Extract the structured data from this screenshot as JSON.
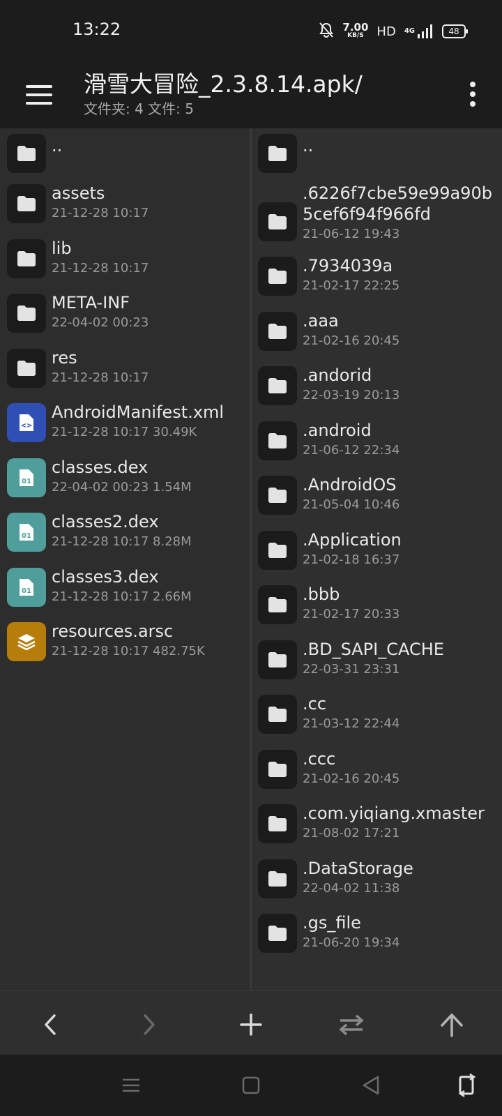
{
  "status_bar": {
    "time": "13:22",
    "net_speed_value": "7.00",
    "net_speed_unit": "KB/S",
    "hd_label": "HD",
    "network_type": "4G",
    "battery": "48",
    "icons": [
      "bell-off-icon",
      "signal-icon",
      "battery-icon"
    ]
  },
  "toolbar": {
    "title": "滑雪大冒险_2.3.8.14.apk/",
    "subtitle": "文件夹: 4  文件: 5",
    "icons": [
      "hamburger-menu-icon",
      "more-vert-icon"
    ]
  },
  "left_pane": {
    "items": [
      {
        "name": "..",
        "meta": "",
        "icon": "folder-icon",
        "type": "folder"
      },
      {
        "name": "assets",
        "meta": "21-12-28 10:17",
        "icon": "folder-icon",
        "type": "folder"
      },
      {
        "name": "lib",
        "meta": "21-12-28 10:17",
        "icon": "folder-icon",
        "type": "folder"
      },
      {
        "name": "META-INF",
        "meta": "22-04-02 00:23",
        "icon": "folder-icon",
        "type": "folder"
      },
      {
        "name": "res",
        "meta": "21-12-28 10:17",
        "icon": "folder-icon",
        "type": "folder"
      },
      {
        "name": "AndroidManifest.xml",
        "meta": "21-12-28 10:17  30.49K",
        "icon": "xml-file-icon",
        "type": "xml"
      },
      {
        "name": "classes.dex",
        "meta": "22-04-02 00:23  1.54M",
        "icon": "dex-file-icon",
        "type": "dex"
      },
      {
        "name": "classes2.dex",
        "meta": "21-12-28 10:17  8.28M",
        "icon": "dex-file-icon",
        "type": "dex"
      },
      {
        "name": "classes3.dex",
        "meta": "21-12-28 10:17  2.66M",
        "icon": "dex-file-icon",
        "type": "dex"
      },
      {
        "name": "resources.arsc",
        "meta": "21-12-28 10:17  482.75K",
        "icon": "layers-file-icon",
        "type": "arsc"
      }
    ]
  },
  "right_pane": {
    "items": [
      {
        "name": "..",
        "meta": "",
        "icon": "folder-icon"
      },
      {
        "name": ".6226f7cbe59e99a90b5cef6f94f966fd",
        "meta": "21-06-12 19:43",
        "icon": "folder-icon"
      },
      {
        "name": ".7934039a",
        "meta": "21-02-17 22:25",
        "icon": "folder-icon"
      },
      {
        "name": ".aaa",
        "meta": "21-02-16 20:45",
        "icon": "folder-icon"
      },
      {
        "name": ".andorid",
        "meta": "22-03-19 20:13",
        "icon": "folder-icon"
      },
      {
        "name": ".android",
        "meta": "21-06-12 22:34",
        "icon": "folder-icon"
      },
      {
        "name": ".AndroidOS",
        "meta": "21-05-04 10:46",
        "icon": "folder-icon"
      },
      {
        "name": ".Application",
        "meta": "21-02-18 16:37",
        "icon": "folder-icon"
      },
      {
        "name": ".bbb",
        "meta": "21-02-17 20:33",
        "icon": "folder-icon"
      },
      {
        "name": ".BD_SAPI_CACHE",
        "meta": "22-03-31 23:31",
        "icon": "folder-icon"
      },
      {
        "name": ".cc",
        "meta": "21-03-12 22:44",
        "icon": "folder-icon"
      },
      {
        "name": ".ccc",
        "meta": "21-02-16 20:45",
        "icon": "folder-icon"
      },
      {
        "name": ".com.yiqiang.xmaster",
        "meta": "21-08-02 17:21",
        "icon": "folder-icon"
      },
      {
        "name": ".DataStorage",
        "meta": "22-04-02 11:38",
        "icon": "folder-icon"
      },
      {
        "name": ".gs_file",
        "meta": "21-06-20 19:34",
        "icon": "folder-icon"
      }
    ]
  },
  "action_bar": {
    "icons": [
      "back-arrow-icon",
      "forward-arrow-icon",
      "add-icon",
      "swap-icon",
      "up-arrow-icon"
    ]
  },
  "nav_bar": {
    "icons": [
      "recents-icon",
      "home-icon",
      "back-icon",
      "rotate-icon"
    ]
  },
  "colors": {
    "background": "#2b2b2b",
    "toolbar": "#1c1c1c",
    "xml_icon": "#2f4fb5",
    "dex_icon": "#4f9e9b",
    "arsc_icon": "#b77d0b"
  }
}
